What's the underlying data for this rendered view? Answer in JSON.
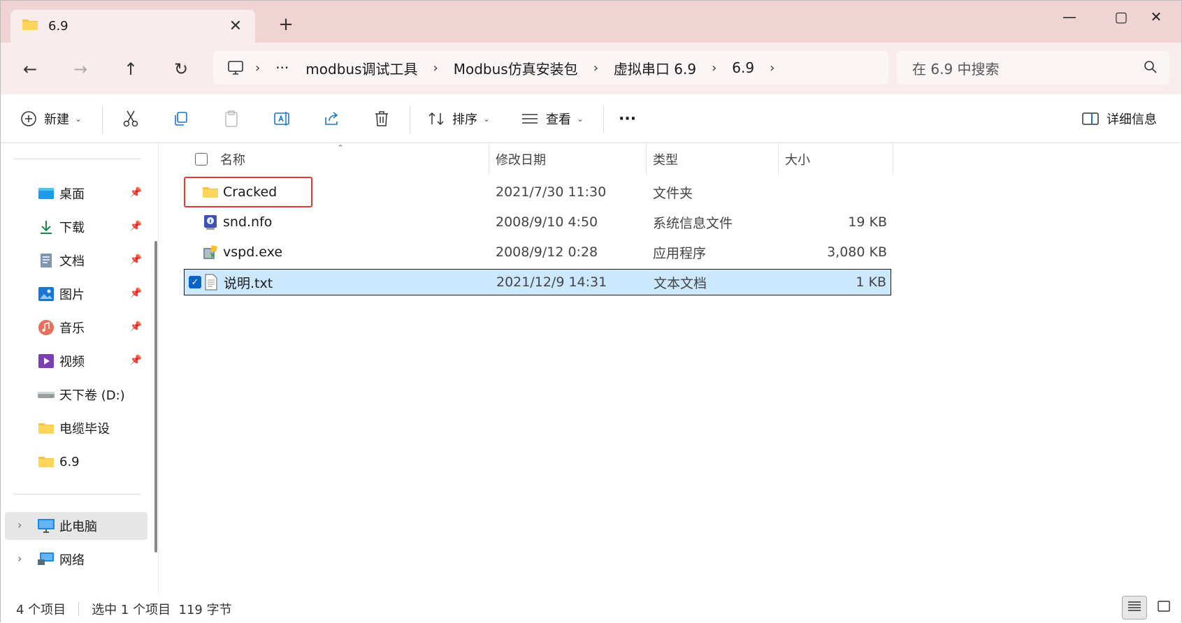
{
  "tab": {
    "title": "6.9",
    "close": "✕",
    "add": "+"
  },
  "window_controls": {
    "minimize": "—",
    "maximize": "▢",
    "close": "✕"
  },
  "nav": {
    "back": "←",
    "forward": "→",
    "up": "↑",
    "refresh": "↻",
    "breadcrumb": [
      "modbus调试工具",
      "Modbus仿真安装包",
      "虚拟串口 6.9",
      "6.9"
    ],
    "ellipsis": "···",
    "sep": "›"
  },
  "search": {
    "placeholder": "在 6.9 中搜索"
  },
  "toolbar": {
    "new_label": "新建",
    "sort_label": "排序",
    "view_label": "查看",
    "more": "···",
    "details_label": "详细信息"
  },
  "sidebar": {
    "quick_access": [
      {
        "label": "桌面",
        "icon": "desktop-icon",
        "pinned": true
      },
      {
        "label": "下载",
        "icon": "download-icon",
        "pinned": true
      },
      {
        "label": "文档",
        "icon": "documents-icon",
        "pinned": true
      },
      {
        "label": "图片",
        "icon": "pictures-icon",
        "pinned": true
      },
      {
        "label": "音乐",
        "icon": "music-icon",
        "pinned": true
      },
      {
        "label": "视频",
        "icon": "videos-icon",
        "pinned": true
      },
      {
        "label": "天下卷 (D:)",
        "icon": "drive-icon",
        "pinned": false
      },
      {
        "label": "电缆毕设",
        "icon": "folder-icon",
        "pinned": false
      },
      {
        "label": "6.9",
        "icon": "folder-icon",
        "pinned": false
      }
    ],
    "this_pc": "此电脑",
    "network": "网络"
  },
  "columns": {
    "name": "名称",
    "date": "修改日期",
    "type": "类型",
    "size": "大小"
  },
  "files": [
    {
      "name": "Cracked",
      "date": "2021/7/30 11:30",
      "type": "文件夹",
      "size": "",
      "icon": "folder-icon",
      "selected": false
    },
    {
      "name": "snd.nfo",
      "date": "2008/9/10 4:50",
      "type": "系统信息文件",
      "size": "19 KB",
      "icon": "system-info-icon",
      "selected": false
    },
    {
      "name": "vspd.exe",
      "date": "2008/9/12 0:28",
      "type": "应用程序",
      "size": "3,080 KB",
      "icon": "installer-icon",
      "selected": false
    },
    {
      "name": "说明.txt",
      "date": "2021/12/9 14:31",
      "type": "文本文档",
      "size": "1 KB",
      "icon": "text-file-icon",
      "selected": true
    }
  ],
  "status": {
    "count": "4 个项目",
    "selection": "选中 1 个项目  119 字节"
  },
  "colors": {
    "titlebar": "#f0d3d3",
    "selection": "#cce8ff",
    "accent": "#0a64c8",
    "highlight": "#e53935"
  }
}
